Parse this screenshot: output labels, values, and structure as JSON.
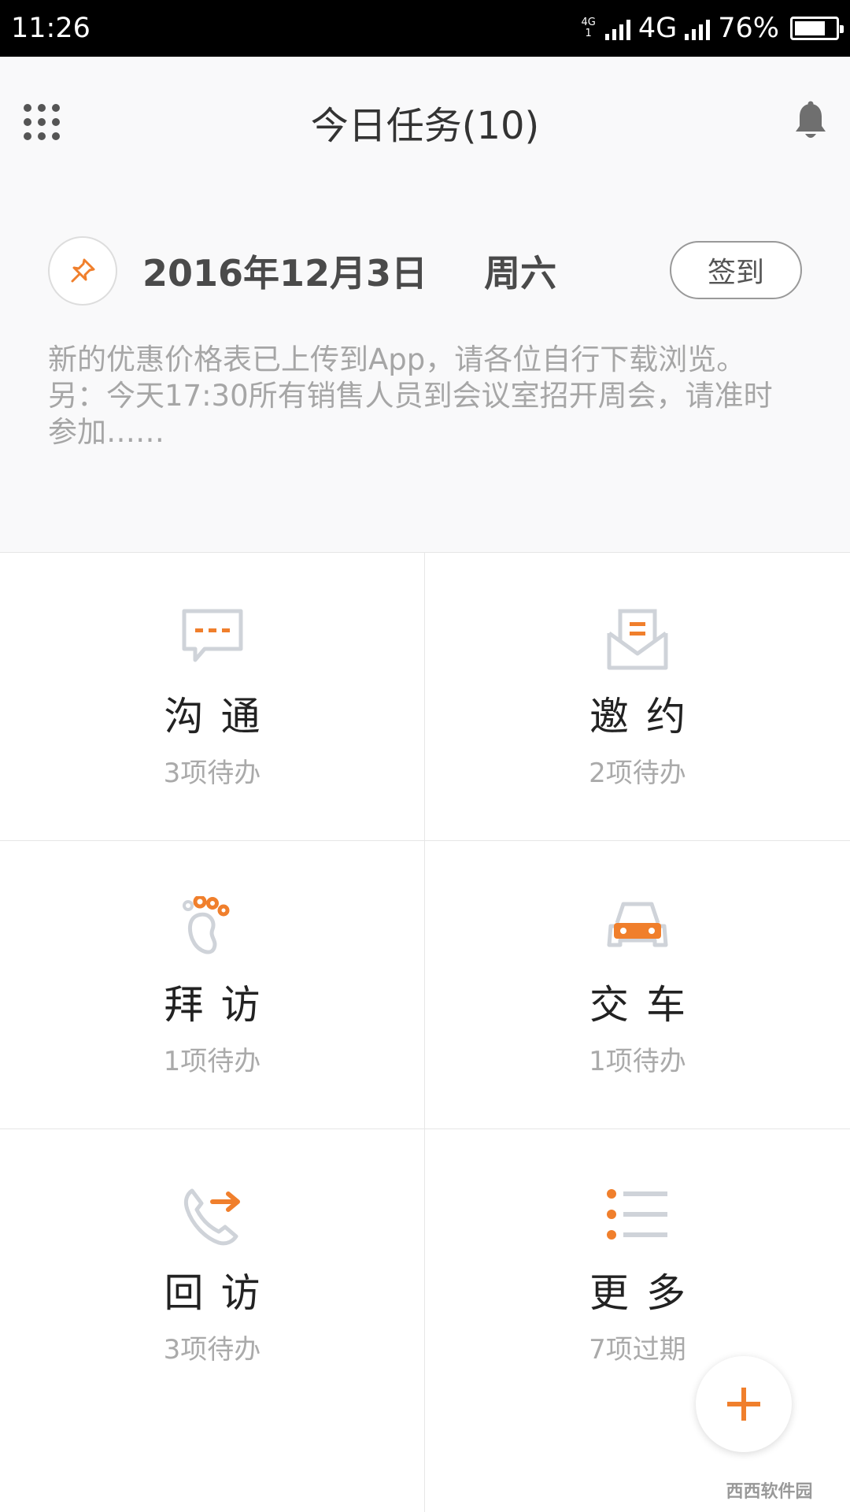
{
  "status_bar": {
    "time": "11:26",
    "net_small_top": "4G",
    "net_small_bottom": "1",
    "network": "4G",
    "battery": "76%",
    "battery_level": 0.76
  },
  "header": {
    "title": "今日任务(10)",
    "date": "2016年12月3日",
    "weekday": "周六",
    "signin_label": "签到",
    "notice_lines": [
      "新的优惠价格表已上传到App，请各位自行下载浏览。",
      "另：今天17:30所有销售人员到会议室招开周会，请准时",
      "参加……"
    ]
  },
  "tiles": [
    {
      "title": "沟通",
      "sub": "3项待办",
      "icon": "chat-icon"
    },
    {
      "title": "邀约",
      "sub": "2项待办",
      "icon": "envelope-icon"
    },
    {
      "title": "拜访",
      "sub": "1项待办",
      "icon": "footprint-icon"
    },
    {
      "title": "交车",
      "sub": "1项待办",
      "icon": "car-icon"
    },
    {
      "title": "回访",
      "sub": "3项待办",
      "icon": "phone-callback-icon"
    },
    {
      "title": "更多",
      "sub": "7项过期",
      "icon": "list-icon"
    }
  ],
  "watermark": "西西软件园",
  "colors": {
    "accent": "#f07f2c",
    "icon_gray": "#cfd3d9",
    "title_text": "#333333",
    "muted_text": "#a6a6a6"
  }
}
